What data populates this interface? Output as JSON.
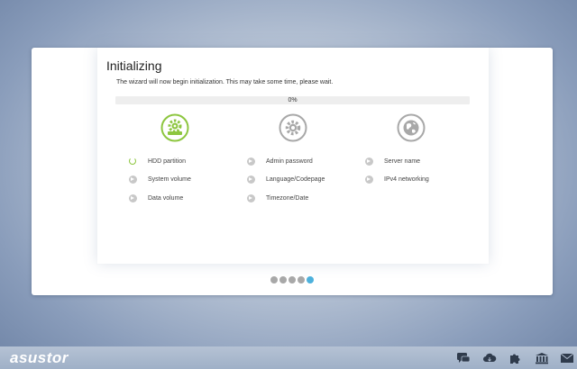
{
  "wizard": {
    "title": "Initializing",
    "message": "The wizard will now begin initialization. This may take some time, please wait.",
    "progress_value": 0,
    "progress_text": "0%",
    "columns": [
      {
        "icon": "hdd-icon",
        "status": "active",
        "steps": [
          {
            "label": "HDD partition",
            "state": "in-progress"
          },
          {
            "label": "System volume",
            "state": "pending"
          },
          {
            "label": "Data volume",
            "state": "pending"
          }
        ]
      },
      {
        "icon": "gear-icon",
        "status": "pending",
        "steps": [
          {
            "label": "Admin password",
            "state": "pending"
          },
          {
            "label": "Language/Codepage",
            "state": "pending"
          },
          {
            "label": "Timezone/Date",
            "state": "pending"
          }
        ]
      },
      {
        "icon": "globe-icon",
        "status": "pending",
        "steps": [
          {
            "label": "Server name",
            "state": "pending"
          },
          {
            "label": "IPv4 networking",
            "state": "pending"
          }
        ]
      }
    ],
    "pager": {
      "count": 5,
      "active_index": 4
    }
  },
  "taskbar": {
    "logo": "asustor",
    "icons": [
      "chat-icon",
      "cloud-icon",
      "puzzle-icon",
      "bank-icon",
      "mail-icon"
    ]
  },
  "colors": {
    "accent_green": "#8dc63f",
    "pager_active": "#4db1dc",
    "inactive_gray": "#a8a8a8"
  }
}
